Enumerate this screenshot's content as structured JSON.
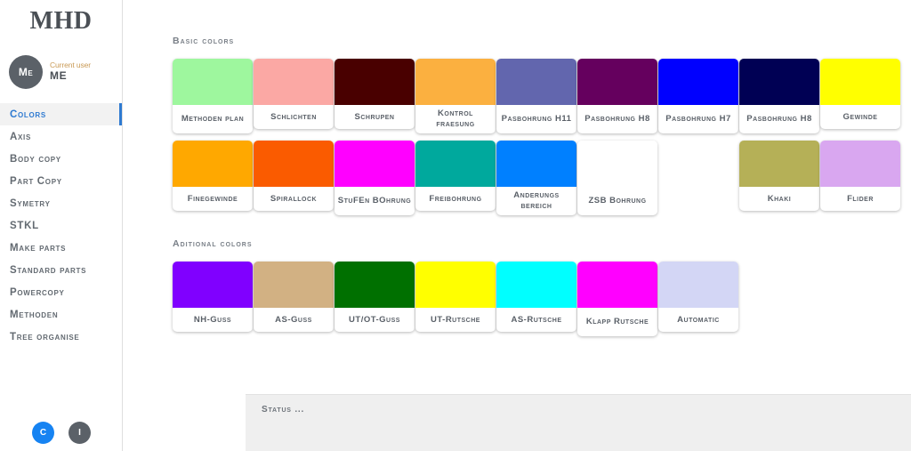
{
  "sidebar": {
    "brand": "MHD",
    "user": {
      "avatar_initials": "Me",
      "role_label": "Current user",
      "name": "ME"
    },
    "items": [
      {
        "label": "Colors",
        "active": true
      },
      {
        "label": "Axis",
        "active": false
      },
      {
        "label": "Body copy",
        "active": false
      },
      {
        "label": "Part Copy",
        "active": false
      },
      {
        "label": "Symetry",
        "active": false
      },
      {
        "label": "STKL",
        "active": false
      },
      {
        "label": "Make parts",
        "active": false
      },
      {
        "label": "Standard parts",
        "active": false
      },
      {
        "label": "Powercopy",
        "active": false
      },
      {
        "label": "Methoden",
        "active": false
      },
      {
        "label": "Tree organise",
        "active": false
      }
    ],
    "dock": [
      {
        "label": "C",
        "color": "#1683f2"
      },
      {
        "label": "I",
        "color": "#5b6168"
      }
    ]
  },
  "main": {
    "sections": [
      {
        "title": "Basic colors",
        "cards": [
          {
            "label": "Methoden plan",
            "color": "#9EF79E",
            "lines": 2
          },
          {
            "label": "Schlichten",
            "color": "#FBA8A4",
            "lines": 1
          },
          {
            "label": "Schrupen",
            "color": "#490000",
            "lines": 1
          },
          {
            "label": "Kontrol fraesung",
            "color": "#FBB040",
            "lines": 2
          },
          {
            "label": "Pasbohrung H11",
            "color": "#6266AE",
            "lines": 2
          },
          {
            "label": "Pasbohrung H8",
            "color": "#65005E",
            "lines": 2
          },
          {
            "label": "Pasbohrung H7",
            "color": "#0000FF",
            "lines": 2
          },
          {
            "label": "Pasbohrung H8",
            "color": "#000054",
            "lines": 2
          },
          {
            "label": "Gewinde",
            "color": "#FFFF00",
            "lines": 1
          },
          {
            "label": "Finegewinde",
            "color": "#FFA800",
            "lines": 1
          },
          {
            "label": "Spirallock",
            "color": "#FA5B00",
            "lines": 1
          },
          {
            "label": "StuFEn BOhrung",
            "color": "#FF00FF",
            "lines": 2
          },
          {
            "label": "Freibohrung",
            "color": "#00A99D",
            "lines": 1
          },
          {
            "label": "Anderungs bereich",
            "color": "#0080FF",
            "lines": 2
          },
          {
            "label": "ZSB Bohrung",
            "color": "#FFFFFF",
            "lines": 2
          },
          {
            "label": "",
            "color": "",
            "lines": 0,
            "spacer": true
          },
          {
            "label": "Khaki",
            "color": "#B5B057",
            "lines": 1
          },
          {
            "label": "Flider",
            "color": "#D9A7F0",
            "lines": 1
          }
        ]
      },
      {
        "title": "Aditional colors",
        "cards": [
          {
            "label": "NH-Guss",
            "color": "#8000FF",
            "lines": 1
          },
          {
            "label": "AS-Guss",
            "color": "#D2B183",
            "lines": 1
          },
          {
            "label": "UT/OT-Guss",
            "color": "#007000",
            "lines": 1
          },
          {
            "label": "UT-Rutsche",
            "color": "#FFFF00",
            "lines": 1
          },
          {
            "label": "AS-Rutsche",
            "color": "#00FFFF",
            "lines": 1
          },
          {
            "label": "Klapp Rutsche",
            "color": "#FF00FF",
            "lines": 2
          },
          {
            "label": "Automatic",
            "color": "#D3D6F5",
            "lines": 1
          }
        ]
      }
    ]
  },
  "statusbar": {
    "text": "Status ..."
  }
}
